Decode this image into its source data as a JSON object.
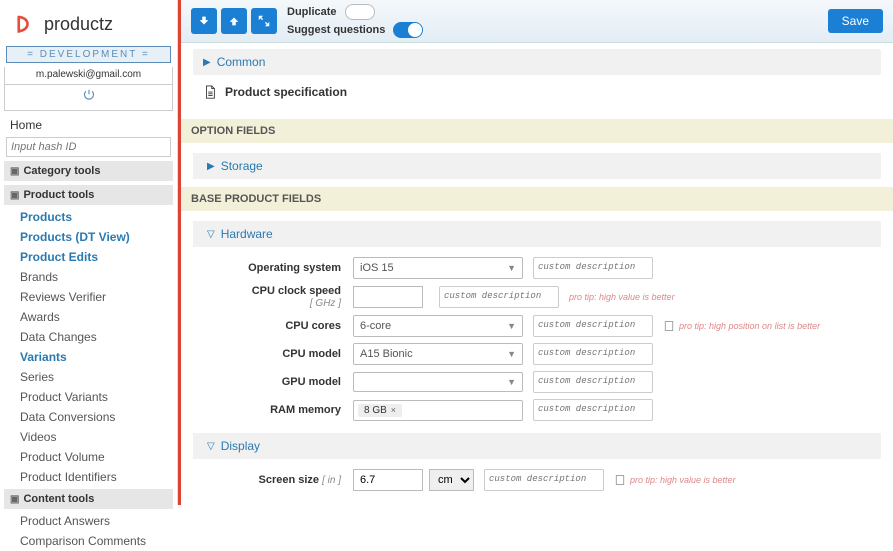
{
  "brand": {
    "name": "productz"
  },
  "sidebar": {
    "env_label": "= DEVELOPMENT =",
    "email": "m.palewski@gmail.com",
    "home": "Home",
    "hash_placeholder": "Input hash ID",
    "sections": {
      "category_tools": "Category tools",
      "product_tools": "Product tools",
      "content_tools": "Content tools"
    },
    "product_items": [
      "Products",
      "Products (DT View)",
      "Product Edits",
      "Brands",
      "Reviews Verifier",
      "Awards",
      "Data Changes",
      "Variants",
      "Series",
      "Product Variants",
      "Data Conversions",
      "Videos",
      "Product Volume",
      "Product Identifiers"
    ],
    "content_items": [
      "Product Answers",
      "Comparison Comments"
    ]
  },
  "topbar": {
    "duplicate": "Duplicate",
    "suggest": "Suggest questions",
    "save": "Save"
  },
  "sections": {
    "common": "Common",
    "product_spec": "Product specification",
    "option_fields": "OPTION FIELDS",
    "storage": "Storage",
    "base_fields": "BASE PRODUCT FIELDS",
    "hardware": "Hardware",
    "display": "Display"
  },
  "fields": {
    "os": {
      "label": "Operating system",
      "value": "iOS 15"
    },
    "clock": {
      "label": "CPU clock speed",
      "unit": "[ GHz ]",
      "tip": "pro tip: high value is better"
    },
    "cores": {
      "label": "CPU cores",
      "value": "6-core",
      "tip": "pro tip: high position on list is better"
    },
    "cpu_model": {
      "label": "CPU model",
      "value": "A15 Bionic"
    },
    "gpu_model": {
      "label": "GPU model",
      "value": ""
    },
    "ram": {
      "label": "RAM memory",
      "value": "8 GB"
    },
    "screen": {
      "label": "Screen size",
      "unit": "[ in ]",
      "value": "6.7",
      "unit_sel": "cm",
      "tip": "pro tip: high value is better"
    },
    "desc_placeholder": "custom description"
  }
}
